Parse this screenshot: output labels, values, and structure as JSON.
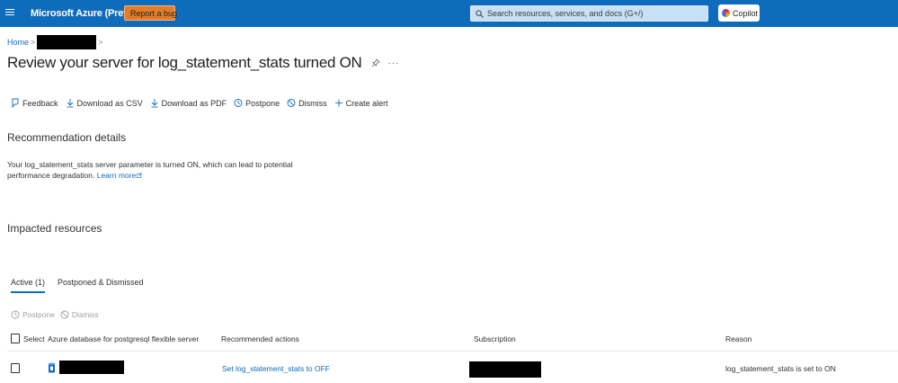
{
  "topbar": {
    "title": "Microsoft Azure (Preview)",
    "report_bug_label": "Report a bug",
    "search_placeholder": "Search resources, services, and docs (G+/)",
    "copilot_label": "Copilot",
    "bar_color": "#0f6cbd",
    "bug_button_color": "#e27d2c"
  },
  "breadcrumb": {
    "home": "Home",
    "separator": ">"
  },
  "page": {
    "title": "Review your server for log_statement_stats turned ON",
    "more": "···"
  },
  "toolbar": {
    "items": [
      {
        "label": "Feedback",
        "icon": "feedback-icon"
      },
      {
        "label": "Download as CSV",
        "icon": "download-icon"
      },
      {
        "label": "Download as PDF",
        "icon": "download-icon"
      },
      {
        "label": "Postpone",
        "icon": "clock-icon"
      },
      {
        "label": "Dismiss",
        "icon": "dismiss-icon"
      },
      {
        "label": "Create alert",
        "icon": "plus-icon"
      }
    ]
  },
  "recommendation": {
    "heading": "Recommendation details",
    "description": "Your log_statement_stats server parameter is turned ON, which can lead to potential performance degradation.",
    "learn_more": "Learn more"
  },
  "impacted": {
    "heading": "Impacted resources",
    "tabs": [
      {
        "label": "Active (1)",
        "active": true
      },
      {
        "label": "Postponed & Dismissed",
        "active": false
      }
    ],
    "actions": [
      {
        "label": "Postpone",
        "icon": "clock-icon",
        "disabled": true
      },
      {
        "label": "Dismiss",
        "icon": "dismiss-icon",
        "disabled": true
      }
    ],
    "columns": {
      "select": "Select",
      "server": "Azure database for postgresql flexible server",
      "actions": "Recommended actions",
      "subscription": "Subscription",
      "reason": "Reason"
    },
    "rows": [
      {
        "action": "Set log_statement_stats to OFF",
        "reason": "log_statement_stats is set to ON"
      }
    ]
  }
}
